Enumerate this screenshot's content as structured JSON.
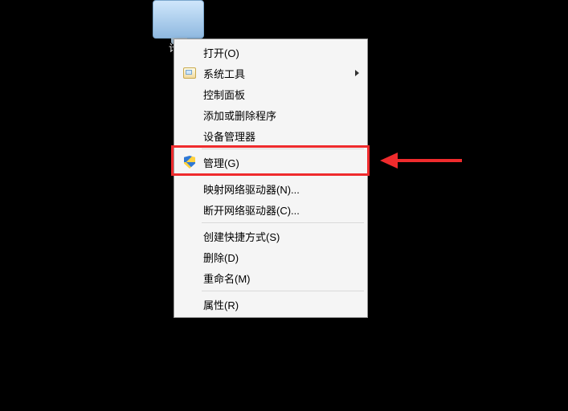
{
  "desktop": {
    "icon_label": "计算"
  },
  "context_menu": {
    "items": [
      {
        "label": "打开(O)",
        "icon": null,
        "submenu": false
      },
      {
        "label": "系统工具",
        "icon": "folder",
        "submenu": true
      },
      {
        "label": "控制面板",
        "icon": null,
        "submenu": false
      },
      {
        "label": "添加或删除程序",
        "icon": null,
        "submenu": false
      },
      {
        "label": "设备管理器",
        "icon": null,
        "submenu": false
      }
    ],
    "manage": {
      "label": "管理(G)",
      "icon": "shield"
    },
    "network": [
      {
        "label": "映射网络驱动器(N)..."
      },
      {
        "label": "断开网络驱动器(C)..."
      }
    ],
    "file_ops": [
      {
        "label": "创建快捷方式(S)"
      },
      {
        "label": "删除(D)"
      },
      {
        "label": "重命名(M)"
      }
    ],
    "properties": {
      "label": "属性(R)"
    }
  },
  "annotation": {
    "highlight_color": "#ef2b2d"
  }
}
